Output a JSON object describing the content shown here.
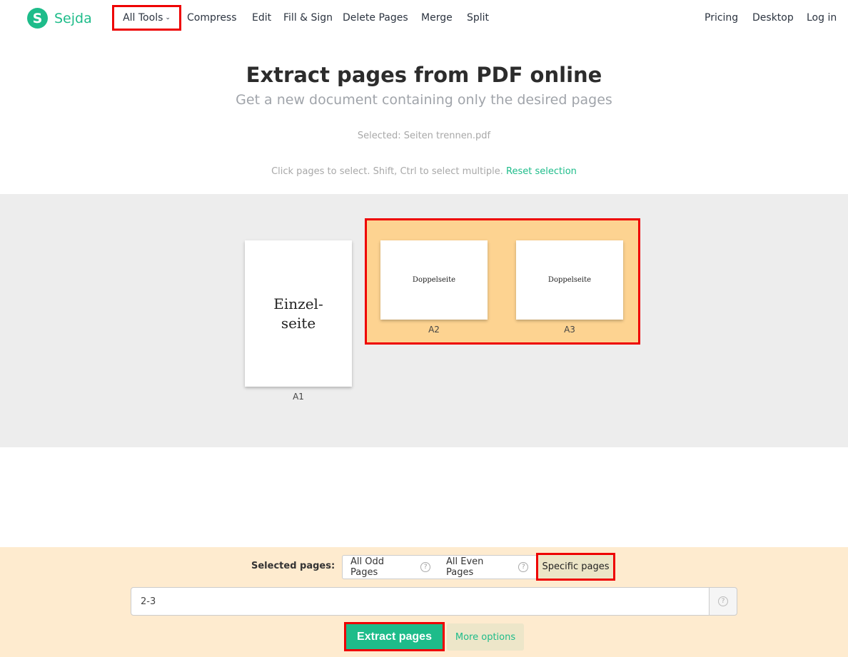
{
  "brand": {
    "logo_letter": "S",
    "name": "Sejda",
    "accent_color": "#1ebc8a"
  },
  "nav": {
    "all_tools": "All Tools",
    "items": [
      "Compress",
      "Edit",
      "Fill & Sign",
      "Delete Pages",
      "Merge",
      "Split"
    ],
    "right_items": [
      "Pricing",
      "Desktop",
      "Log in"
    ]
  },
  "header": {
    "title": "Extract pages from PDF online",
    "subtitle": "Get a new document containing only the desired pages",
    "selected_file": "Selected: Seiten trennen.pdf",
    "hint": "Click pages to select. Shift, Ctrl to select multiple.",
    "reset_link": "Reset selection"
  },
  "pages": [
    {
      "label": "A1",
      "content": "Einzel-\nseite",
      "selected": false
    },
    {
      "label": "A2",
      "content": "Doppelseite",
      "selected": true
    },
    {
      "label": "A3",
      "content": "Doppelseite",
      "selected": true
    }
  ],
  "options": {
    "selected_pages_label": "Selected pages:",
    "modes": [
      "All Odd Pages",
      "All Even Pages",
      "Specific pages"
    ],
    "active_mode": "Specific pages",
    "help_glyph": "?",
    "range_value": "2-3",
    "extract_button": "Extract pages",
    "more_options": "More options"
  }
}
